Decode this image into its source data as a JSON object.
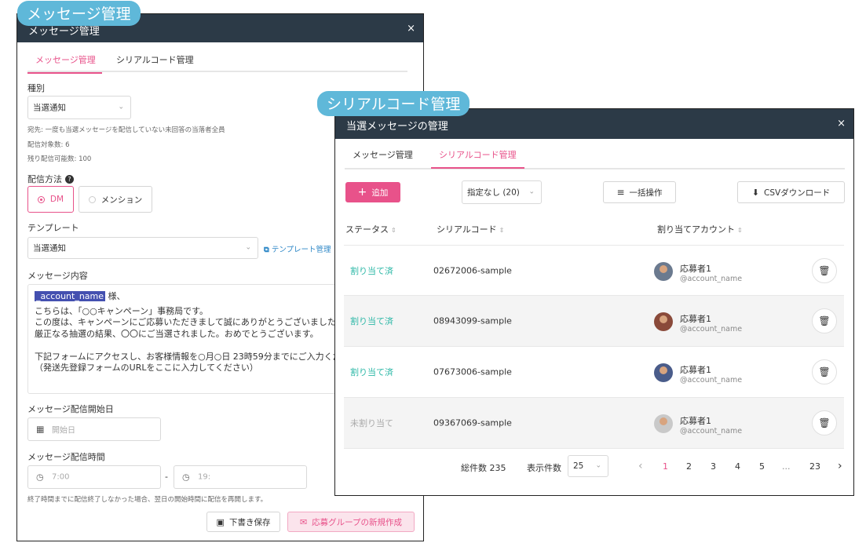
{
  "tags": {
    "left": "メッセージ管理",
    "right": "シリアルコード管理"
  },
  "left_window": {
    "title": "メッセージ管理",
    "close": "×",
    "tabs": [
      "メッセージ管理",
      "シリアルコード管理"
    ],
    "type_label": "種別",
    "type_value": "当選通知",
    "notes": [
      "宛先: 一度も当選メッセージを配信していない未回答の当落者全員",
      "配信対象数: 6",
      "残り配信可能数: 100"
    ],
    "method_label": "配信方法",
    "method_options": [
      "DM",
      "メンション"
    ],
    "template_label": "テンプレート",
    "template_value": "当選通知",
    "template_link": "テンプレート管理",
    "content_label": "メッセージ内容",
    "content": {
      "token": "_account_name",
      "suffix": "様、",
      "lines": [
        "こちらは、「○○キャンペーン」事務局です。",
        "この度は、キャンペーンにご応募いただきまして誠にありがとうございました。",
        "厳正なる抽選の結果、〇〇にご当選されました。おめでとうございます。",
        "",
        "下記フォームにアクセスし、お客様情報を○月○日 23時59分までにご入力ください。",
        "（発送先登録フォームのURLをここに入力してください）"
      ]
    },
    "start_label": "メッセージ配信開始日",
    "start_placeholder": "開始日",
    "time_label": "メッセージ配信時間",
    "time_from": "7:00",
    "time_sep": "-",
    "time_to": "19:",
    "time_note": "終了時間までに配信終了しなかった場合、翌日の開始時間に配信を再開します。",
    "draft_button": "下書き保存",
    "create_button": "応募グループの新規作成"
  },
  "right_window": {
    "title": "当選メッセージの管理",
    "close": "×",
    "tabs": [
      "メッセージ管理",
      "シリアルコード管理"
    ],
    "add_button": "追加",
    "filter_value": "指定なし (20)",
    "bulk_button": "一括操作",
    "csv_button": "CSVダウンロード",
    "columns": [
      "ステータス",
      "シリアルコード",
      "割り当てアカウント"
    ],
    "rows": [
      {
        "status": "割り当て済",
        "code": "02672006-sample",
        "name": "応募者1",
        "account": "@account_name"
      },
      {
        "status": "割り当て済",
        "code": "08943099-sample",
        "name": "応募者1",
        "account": "@account_name"
      },
      {
        "status": "割り当て済",
        "code": "07673006-sample",
        "name": "応募者1",
        "account": "@account_name"
      },
      {
        "status": "未割り当て",
        "code": "09367069-sample",
        "name": "応募者1",
        "account": "@account_name"
      }
    ],
    "footer": {
      "total": "総件数 235",
      "per_page_label": "表示件数",
      "per_page_value": "25",
      "pages": [
        "1",
        "2",
        "3",
        "4",
        "5",
        "...",
        "23"
      ],
      "prev": "‹",
      "next": "›"
    }
  }
}
